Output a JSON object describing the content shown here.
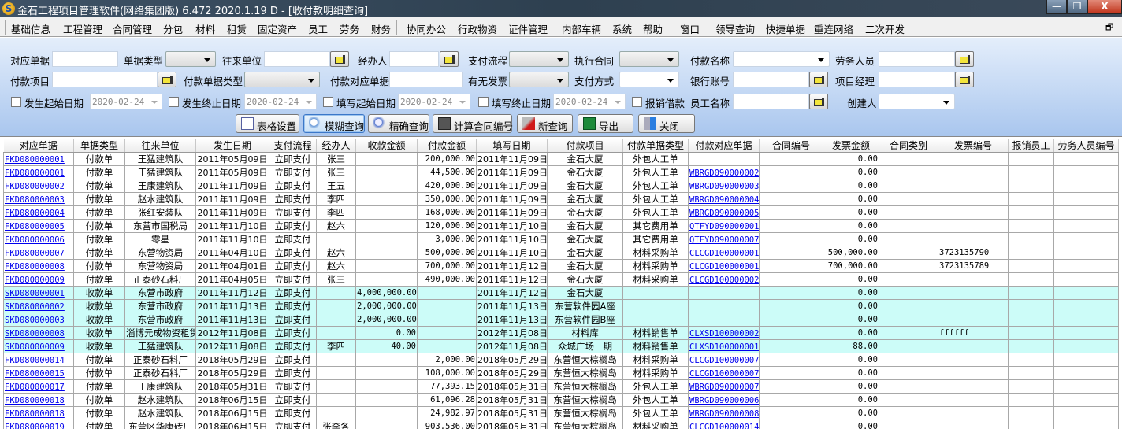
{
  "title": "金石工程项目管理软件(网络集团版) 6.472  2020.1.19 D - [收付款明细查询]",
  "logo": "S",
  "window_controls": {
    "min": "—",
    "restore": "❐",
    "close": "X"
  },
  "menu": [
    "基础信息",
    "工程管理",
    "合同管理",
    "分包",
    "材料",
    "租赁",
    "固定资产",
    "员工",
    "劳务",
    "财务",
    "协同办公",
    "行政物资",
    "证件管理",
    "内部车辆",
    "系统",
    "帮助",
    "窗口",
    "领导查询",
    "快捷单据",
    "重连网络",
    "二次开发"
  ],
  "mdi_controls": {
    "min": "_",
    "restore": "🗗"
  },
  "filters": {
    "row1": [
      "对应单据",
      "单据类型",
      "往来单位",
      "经办人",
      "支付流程",
      "执行合同",
      "付款名称",
      "劳务人员"
    ],
    "row2": [
      "付款项目",
      "付款单据类型",
      "付款对应单据",
      "有无发票",
      "支付方式",
      "银行账号",
      "项目经理"
    ],
    "row3": [
      "发生起始日期",
      "发生终止日期",
      "填写起始日期",
      "填写终止日期",
      "报销借款",
      "员工名称",
      "创建人"
    ],
    "date_value": "2020-02-24"
  },
  "buttons": [
    "表格设置",
    "模糊查询",
    "精确查询",
    "计算合同编号",
    "新查询",
    "导出",
    "关闭"
  ],
  "table": {
    "columns": [
      "对应单据",
      "单据类型",
      "往来单位",
      "发生日期",
      "支付流程",
      "经办人",
      "收款金额",
      "付款金额",
      "填写日期",
      "付款项目",
      "付款单据类型",
      "付款对应单据",
      "合同编号",
      "发票金额",
      "合同类别",
      "发票编号",
      "报销员工",
      "劳务人员编号"
    ],
    "rows": [
      [
        "FKD080000001",
        "付款单",
        "王猛建筑队",
        "2011年05月09日",
        "立即支付",
        "张三",
        "",
        "200,000.00",
        "2011年11月09日",
        "金石大厦",
        "外包人工单",
        "",
        "",
        "0.00",
        "",
        "",
        "",
        ""
      ],
      [
        "FKD080000001",
        "付款单",
        "王猛建筑队",
        "2011年05月09日",
        "立即支付",
        "张三",
        "",
        "44,500.00",
        "2011年11月09日",
        "金石大厦",
        "外包人工单",
        "WBRGD090000002",
        "",
        "0.00",
        "",
        "",
        "",
        ""
      ],
      [
        "FKD080000002",
        "付款单",
        "王康建筑队",
        "2011年11月09日",
        "立即支付",
        "王五",
        "",
        "420,000.00",
        "2011年11月09日",
        "金石大厦",
        "外包人工单",
        "WBRGD090000003",
        "",
        "0.00",
        "",
        "",
        "",
        ""
      ],
      [
        "FKD080000003",
        "付款单",
        "赵水建筑队",
        "2011年11月09日",
        "立即支付",
        "李四",
        "",
        "350,000.00",
        "2011年11月09日",
        "金石大厦",
        "外包人工单",
        "WBRGD090000004",
        "",
        "0.00",
        "",
        "",
        "",
        ""
      ],
      [
        "FKD080000004",
        "付款单",
        "张红安装队",
        "2011年11月09日",
        "立即支付",
        "李四",
        "",
        "168,000.00",
        "2011年11月09日",
        "金石大厦",
        "外包人工单",
        "WBRGD090000005",
        "",
        "0.00",
        "",
        "",
        "",
        ""
      ],
      [
        "FKD080000005",
        "付款单",
        "东营市国税局",
        "2011年11月10日",
        "立即支付",
        "赵六",
        "",
        "120,000.00",
        "2011年11月10日",
        "金石大厦",
        "其它费用单",
        "QTFYD090000001",
        "",
        "0.00",
        "",
        "",
        "",
        ""
      ],
      [
        "FKD080000006",
        "付款单",
        "零星",
        "2011年11月10日",
        "立即支付",
        "",
        "",
        "3,000.00",
        "2011年11月10日",
        "金石大厦",
        "其它费用单",
        "QTFYD090000007",
        "",
        "0.00",
        "",
        "",
        "",
        ""
      ],
      [
        "FKD080000007",
        "付款单",
        "东营物资局",
        "2011年04月10日",
        "立即支付",
        "赵六",
        "",
        "500,000.00",
        "2011年11月10日",
        "金石大厦",
        "材料采购单",
        "CLCGD100000001",
        "",
        "500,000.00",
        "",
        "3723135790",
        "",
        ""
      ],
      [
        "FKD080000008",
        "付款单",
        "东营物资局",
        "2011年04月01日",
        "立即支付",
        "赵六",
        "",
        "700,000.00",
        "2011年11月12日",
        "金石大厦",
        "材料采购单",
        "CLCGD100000001",
        "",
        "700,000.00",
        "",
        "3723135789",
        "",
        ""
      ],
      [
        "FKD080000009",
        "付款单",
        "正泰砂石料厂",
        "2011年04月05日",
        "立即支付",
        "张三",
        "",
        "490,000.00",
        "2011年11月12日",
        "金石大厦",
        "材料采购单",
        "CLCGD100000002",
        "",
        "0.00",
        "",
        "",
        "",
        ""
      ],
      [
        "SKD080000001",
        "收款单",
        "东营市政府",
        "2011年11月12日",
        "立即支付",
        "",
        "4,000,000.00",
        "",
        "2011年11月12日",
        "金石大厦",
        "",
        "",
        "",
        "0.00",
        "",
        "",
        "",
        ""
      ],
      [
        "SKD080000002",
        "收款单",
        "东营市政府",
        "2011年11月13日",
        "立即支付",
        "",
        "2,000,000.00",
        "",
        "2011年11月13日",
        "东营软件园A座",
        "",
        "",
        "",
        "0.00",
        "",
        "",
        "",
        ""
      ],
      [
        "SKD080000003",
        "收款单",
        "东营市政府",
        "2011年11月13日",
        "立即支付",
        "",
        "2,000,000.00",
        "",
        "2011年11月13日",
        "东营软件园B座",
        "",
        "",
        "",
        "0.00",
        "",
        "",
        "",
        ""
      ],
      [
        "SKD080000008",
        "收款单",
        "淄博元成物资租赁",
        "2012年11月08日",
        "立即支付",
        "",
        "0.00",
        "",
        "2012年11月08日",
        "材料库",
        "材料销售单",
        "CLXSD100000002",
        "",
        "0.00",
        "",
        "ffffff",
        "",
        ""
      ],
      [
        "SKD080000009",
        "收款单",
        "王猛建筑队",
        "2012年11月08日",
        "立即支付",
        "李四",
        "40.00",
        "",
        "2012年11月08日",
        "众城广场一期",
        "材料销售单",
        "CLXSD100000001",
        "",
        "88.00",
        "",
        "",
        "",
        ""
      ],
      [
        "FKD080000014",
        "付款单",
        "正泰砂石料厂",
        "2018年05月29日",
        "立即支付",
        "",
        "",
        "2,000.00",
        "2018年05月29日",
        "东营恒大棕榈岛",
        "材料采购单",
        "CLCGD100000007",
        "",
        "0.00",
        "",
        "",
        "",
        ""
      ],
      [
        "FKD080000015",
        "付款单",
        "正泰砂石料厂",
        "2018年05月29日",
        "立即支付",
        "",
        "",
        "108,000.00",
        "2018年05月29日",
        "东营恒大棕榈岛",
        "材料采购单",
        "CLCGD100000007",
        "",
        "0.00",
        "",
        "",
        "",
        ""
      ],
      [
        "FKD080000017",
        "付款单",
        "王康建筑队",
        "2018年05月31日",
        "立即支付",
        "",
        "",
        "77,393.15",
        "2018年05月31日",
        "东营恒大棕榈岛",
        "外包人工单",
        "WBRGD090000007",
        "",
        "0.00",
        "",
        "",
        "",
        ""
      ],
      [
        "FKD080000018",
        "付款单",
        "赵水建筑队",
        "2018年06月15日",
        "立即支付",
        "",
        "",
        "61,096.28",
        "2018年05月31日",
        "东营恒大棕榈岛",
        "外包人工单",
        "WBRGD090000006",
        "",
        "0.00",
        "",
        "",
        "",
        ""
      ],
      [
        "FKD080000018",
        "付款单",
        "赵水建筑队",
        "2018年06月15日",
        "立即支付",
        "",
        "",
        "24,982.97",
        "2018年05月31日",
        "东营恒大棕榈岛",
        "外包人工单",
        "WBRGD090000008",
        "",
        "0.00",
        "",
        "",
        "",
        ""
      ],
      [
        "FKD080000019",
        "付款单",
        "东营区华康砖厂",
        "2018年06月15日",
        "立即支付",
        "张李各",
        "",
        "903,536.00",
        "2018年05月31日",
        "东营恒大棕榈岛",
        "材料采购单",
        "CLCGD100000014",
        "",
        "0.00",
        "",
        "",
        "",
        ""
      ]
    ]
  },
  "colors": {
    "receipt_row": "#ccfcf8",
    "link": "#0000ee"
  }
}
